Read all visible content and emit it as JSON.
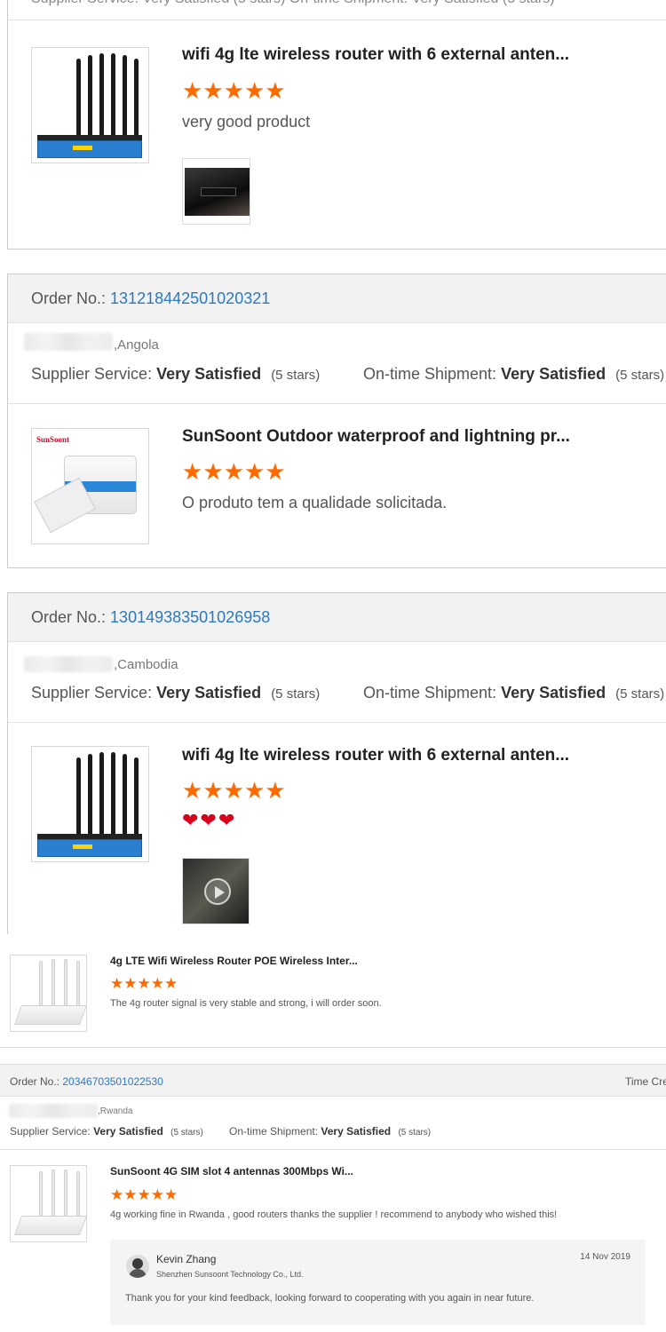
{
  "top_partial": {
    "header_fragment": "Supplier Service: Very Satisfied (5 stars)   On-time Shipment: Very Satisfied (5 stars)"
  },
  "review1": {
    "title": "wifi 4g lte wireless router with 6 external anten...",
    "rating": 5,
    "text": "very good product",
    "product_icon": "router-6-antenna-image"
  },
  "order2": {
    "label": "Order No.:",
    "number": "131218442501020321",
    "country": ",Angola",
    "supplier_label": "Supplier Service:",
    "supplier_value": "Very Satisfied",
    "supplier_stars": "(5 stars)",
    "shipment_label": "On-time Shipment:",
    "shipment_value": "Very Satisfied",
    "shipment_stars": "(5 stars)",
    "review": {
      "title": "SunSoont Outdoor waterproof and lightning pr...",
      "rating": 5,
      "text": "O produto tem a qualidade solicitada.",
      "brand_mark": "SunSoont"
    }
  },
  "order3": {
    "label": "Order No.:",
    "number": "130149383501026958",
    "country": ",Cambodia",
    "supplier_label": "Supplier Service:",
    "supplier_value": "Very Satisfied",
    "supplier_stars": "(5 stars)",
    "shipment_label": "On-time Shipment:",
    "shipment_value": "Very Satisfied",
    "shipment_stars": "(5 stars)",
    "review": {
      "title": "wifi 4g lte wireless router with 6 external anten...",
      "rating": 5,
      "text_emoji": "❤❤❤"
    }
  },
  "review4": {
    "title": "4g LTE Wifi Wireless Router POE Wireless Inter...",
    "rating": 5,
    "text": "The 4g router signal is very stable and strong, i will order soon."
  },
  "order5": {
    "label": "Order No.:",
    "number": "20346703501022530",
    "time_label": "Time Cre",
    "country": ",Rwanda",
    "supplier_label": "Supplier Service:",
    "supplier_value": "Very Satisfied",
    "supplier_stars": "(5 stars)",
    "shipment_label": "On-time Shipment:",
    "shipment_value": "Very Satisfied",
    "shipment_stars": "(5 stars)",
    "review": {
      "title": "SunSoont 4G SIM slot 4 antennas 300Mbps Wi...",
      "rating": 5,
      "text": "4g working fine in Rwanda , good routers thanks the supplier ! recommend to anybody who wished this!"
    },
    "reply": {
      "name": "Kevin Zhang",
      "company": "Shenzhen Sunsoont Technology Co., Ltd.",
      "date": "14 Nov 2019",
      "text": "Thank you for your kind feedback, looking forward to cooperating with you again in near future."
    }
  },
  "colors": {
    "star": "#ff6a00",
    "link": "#2b79c2",
    "header_bg": "#f2f2f2"
  }
}
